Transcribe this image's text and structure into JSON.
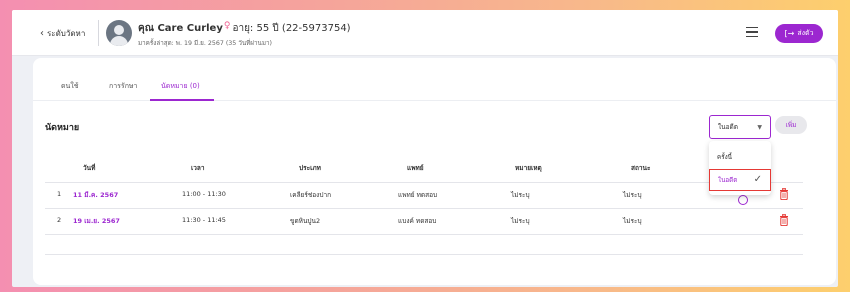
{
  "header": {
    "back_label": "ระดับวัดหา",
    "patient_name": "คุณ Care Curley",
    "gender_symbol": "♀",
    "age_text": "อายุ: 55 ปี (22-5973754)",
    "last_visit": "มาครั้งล่าสุด: พ. 19 มี.ย. 2567 (35 วันที่ผ่านมา)",
    "send_label": "ส่งตัว"
  },
  "tabs": [
    {
      "label": "ดนใช้"
    },
    {
      "label": "การรักษา"
    },
    {
      "label": "นัดหมาย (0)"
    }
  ],
  "section": {
    "title": "นัดหมาย",
    "filter_value": "ในอดีต",
    "add_label": "เพิ่ม"
  },
  "dropdown": {
    "options": [
      {
        "label": "ครั้งนี้"
      },
      {
        "label": "ในอดีต",
        "check": "✓"
      }
    ]
  },
  "table": {
    "columns": [
      "วันที่",
      "เวลา",
      "ประเภท",
      "แพทย์",
      "หมายเหตุ",
      "สถานะ"
    ],
    "rows": [
      {
        "index": "1",
        "date": "11 มี.ค. 2567",
        "time": "11:00 - 11:30",
        "type": "เคลียร์ช่องปาก",
        "doctor": "แพทย์ ทดสอบ",
        "note": "ไม่ระบุ",
        "status": "ไม่ระบุ"
      },
      {
        "index": "2",
        "date": "19 เม.ย. 2567",
        "time": "11:30 - 11:45",
        "type": "ขูดหินปูน2",
        "doctor": "แบงค์ ทดสอบ",
        "note": "ไม่ระบุ",
        "status": "ไม่ระบุ"
      }
    ]
  },
  "colors": {
    "accent": "#9c27d0",
    "danger": "#e53935"
  }
}
